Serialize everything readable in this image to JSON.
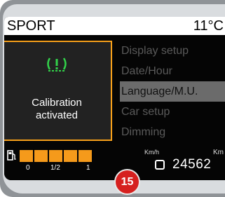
{
  "header": {
    "mode": "SPORT",
    "temperature": "11°C"
  },
  "popup": {
    "icon": "tire-pressure-warning-icon",
    "icon_color": "#32d24a",
    "border_color": "#f7a01a",
    "line1": "Calibration",
    "line2": "activated"
  },
  "menu": {
    "items": [
      {
        "label": "Display setup",
        "selected": false
      },
      {
        "label": "Date/Hour",
        "selected": false
      },
      {
        "label": "Language/M.U.",
        "selected": true
      },
      {
        "label": "Car setup",
        "selected": false
      },
      {
        "label": "Dimming",
        "selected": false
      }
    ]
  },
  "fuel": {
    "segments": 5,
    "fill_fraction": 1.0,
    "color": "#f59a1b",
    "scale": [
      "0",
      "1/2",
      "1"
    ]
  },
  "speed_unit": "Km/h",
  "odometer": {
    "unit": "Km",
    "value": "24562"
  },
  "callout": {
    "number": "15",
    "color": "#d6201f"
  }
}
